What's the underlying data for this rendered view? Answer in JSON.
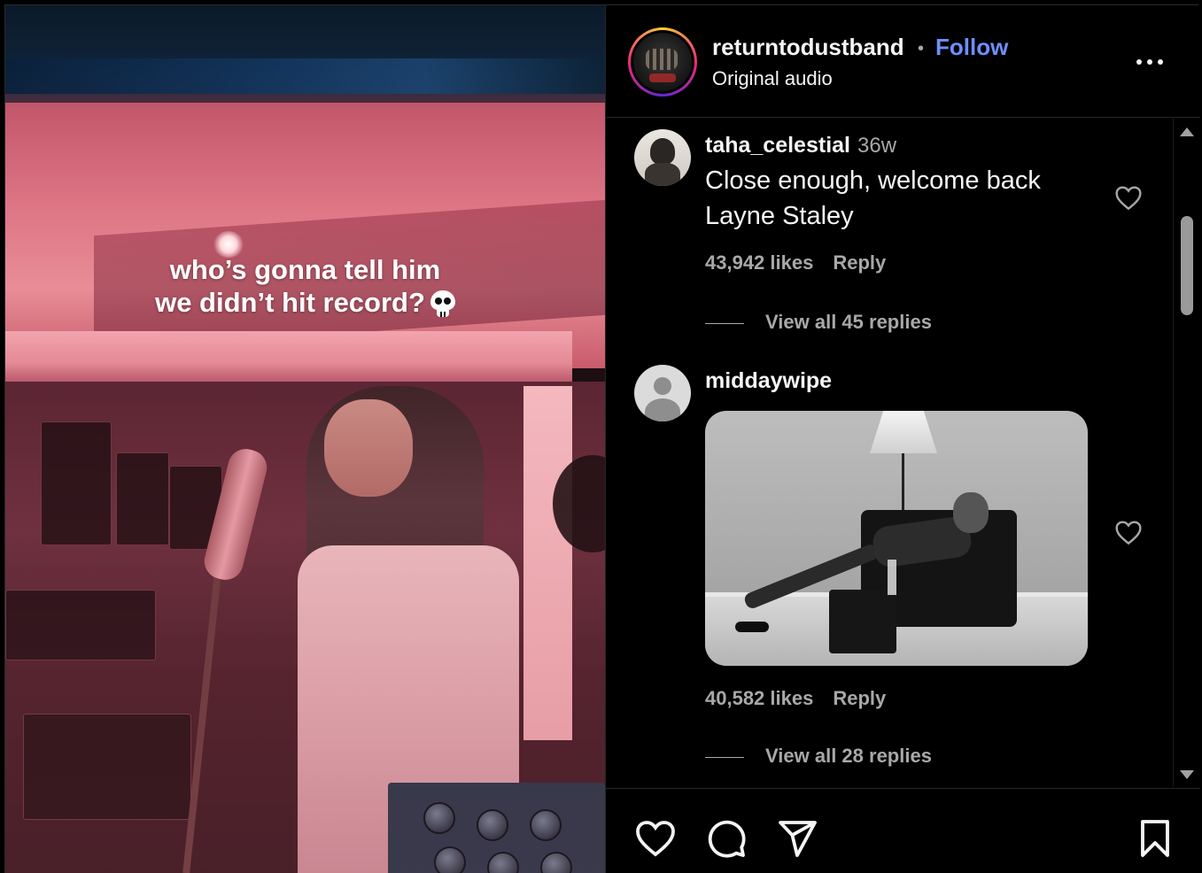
{
  "video": {
    "caption_line1": "who’s gonna tell him",
    "caption_line2": "we didn’t hit record?",
    "caption_emoji_icon": "skull-icon"
  },
  "header": {
    "username": "returntodustband",
    "separator": "•",
    "follow_label": "Follow",
    "audio_label": "Original audio",
    "more_icon": "more-options-icon"
  },
  "comments": [
    {
      "username": "taha_celestial",
      "time": "36w",
      "text": "Close enough, welcome back Layne Staley",
      "likes": "43,942 likes",
      "reply_label": "Reply",
      "view_replies": "View all 45 replies",
      "avatar": "user-photo-avatar"
    },
    {
      "username": "middaywipe",
      "time": "",
      "text": "",
      "likes": "40,582 likes",
      "reply_label": "Reply",
      "view_replies": "View all 28 replies",
      "avatar": "default-avatar",
      "attachment": "gif-image"
    }
  ],
  "actions": {
    "like_icon": "heart-icon",
    "comment_icon": "comment-icon",
    "share_icon": "share-icon",
    "save_icon": "bookmark-icon"
  },
  "colors": {
    "background": "#000000",
    "text": "#f5f5f5",
    "muted": "#a8a8a8",
    "follow": "#6f8fff"
  }
}
